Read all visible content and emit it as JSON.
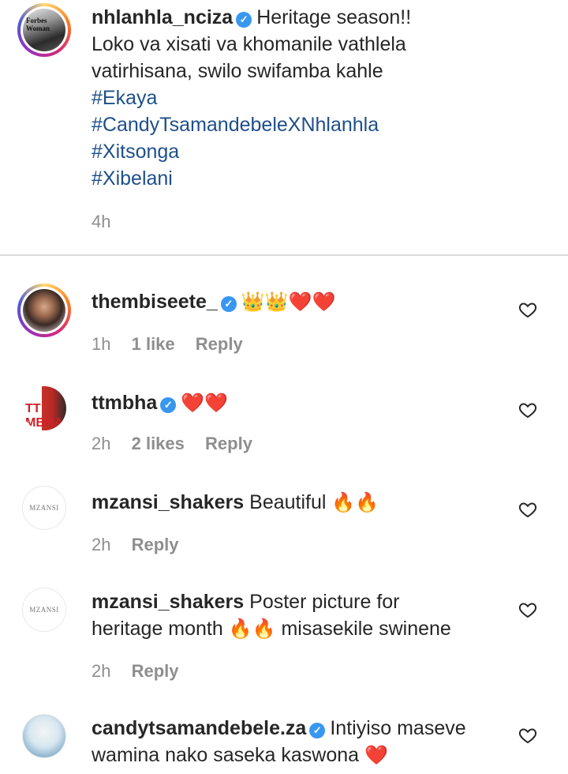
{
  "caption": {
    "username": "nhlanhla_nciza",
    "text_line1": "Heritage season!!",
    "text_line2": "Loko va xisati va khomanile vathlela",
    "text_line3": "vatirhisana, swilo swifamba kahle",
    "hashtags": [
      "#Ekaya",
      "#CandyTsamandebeleXNhlanhla",
      "#Xitsonga",
      "#Xibelani"
    ],
    "time": "4h",
    "avatar_text": "Forbes Woman"
  },
  "comments": [
    {
      "username": "thembiseete_",
      "verified": true,
      "emoji": "👑👑❤️❤️",
      "time": "1h",
      "likes": "1 like",
      "reply": "Reply"
    },
    {
      "username": "ttmbha",
      "verified": true,
      "emoji": "❤️❤️",
      "time": "2h",
      "likes": "2 likes",
      "reply": "Reply",
      "avatar_text": "TT MBHA"
    },
    {
      "username": "mzansi_shakers",
      "text": "Beautiful",
      "emoji": "🔥🔥",
      "time": "2h",
      "reply": "Reply",
      "avatar_text": "MZANSI"
    },
    {
      "username": "mzansi_shakers",
      "text_line1": "Poster picture for",
      "text_line2a": "heritage month",
      "emoji": "🔥🔥",
      "text_line2b": "misasekile swinene",
      "time": "2h",
      "reply": "Reply",
      "avatar_text": "MZANSI"
    },
    {
      "username": "candytsamandebele.za",
      "verified": true,
      "text_line1": "Intiyiso maseve",
      "text_line2": "wamina nako saseka kaswona",
      "emoji": "❤️"
    }
  ],
  "icons": {
    "verified": "verified-badge-icon",
    "like": "heart-outline-icon"
  },
  "colors": {
    "hashtag": "#1e4f8a",
    "verified": "#3897f0",
    "meta": "#8e8e8e"
  }
}
